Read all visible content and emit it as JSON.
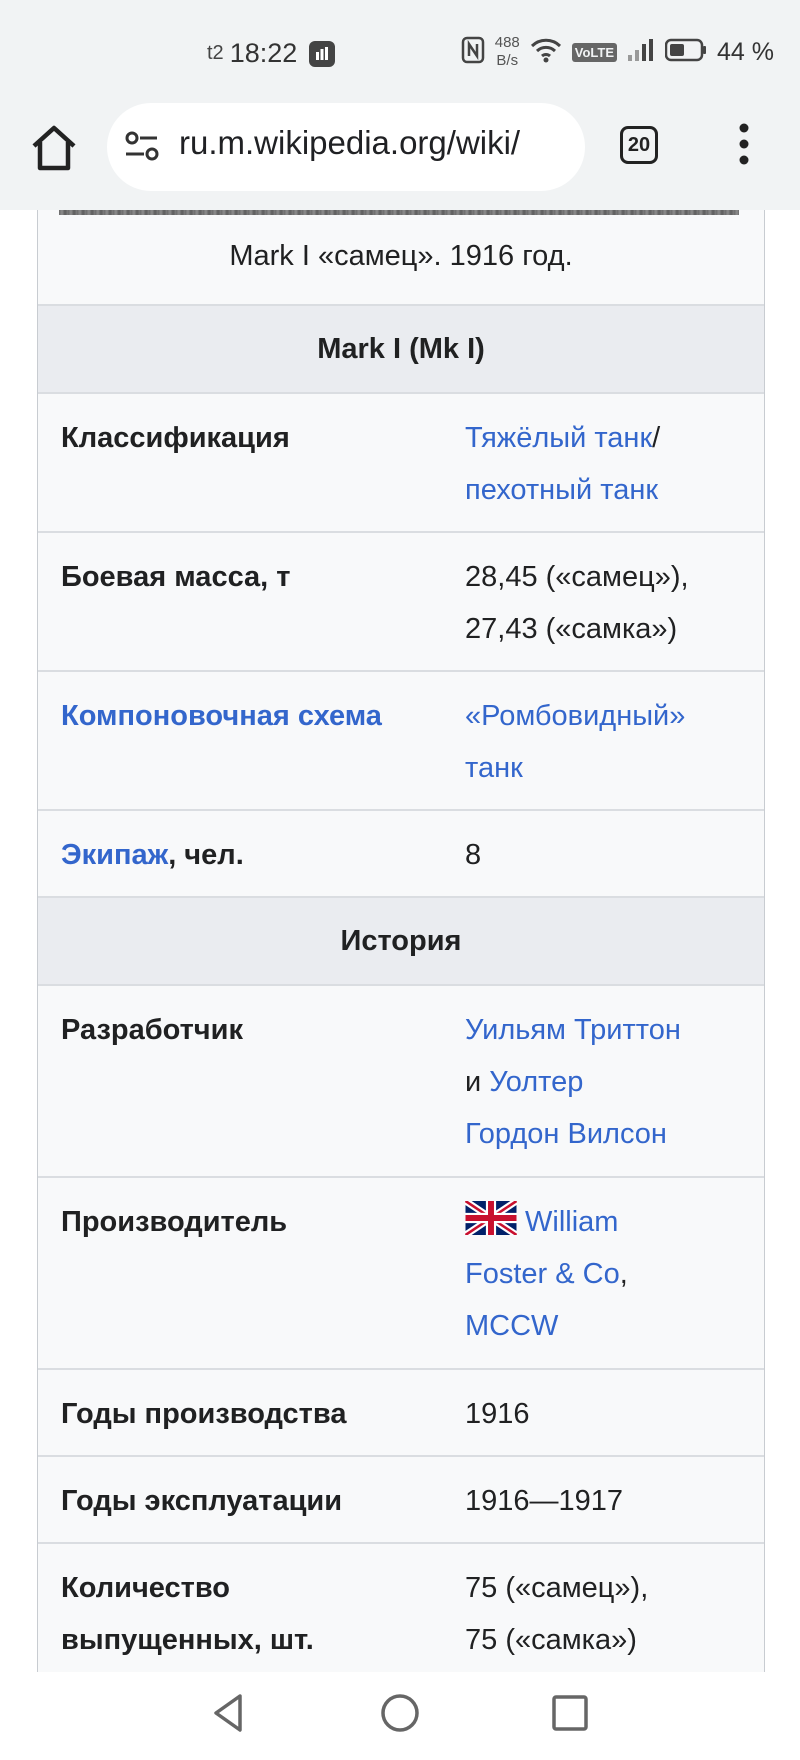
{
  "status_bar": {
    "carrier": "t2",
    "time": "18:22",
    "net_speed_value": "488",
    "net_speed_unit": "B/s",
    "volte": "VoLTE",
    "battery_percent": "44 %"
  },
  "browser": {
    "url": "ru.m.wikipedia.org/wiki/",
    "tab_count": "20"
  },
  "infobox": {
    "caption": "Mark I «самец». 1916 год.",
    "section_main": "Mark I (Mk I)",
    "classification": {
      "label": "Классификация",
      "link1": "Тяжёлый танк",
      "sep": "/",
      "link2": "пехотный танк"
    },
    "mass": {
      "label": "Боевая масса, т",
      "line1": "28,45 («самец»),",
      "line2": "27,43 («самка»)"
    },
    "layout": {
      "label": "Компоновочная схема",
      "line1": "«Ромбовидный»",
      "line2": "танк"
    },
    "crew": {
      "label_link": "Экипаж",
      "label_rest": ", чел.",
      "value": "8"
    },
    "section_history": "История",
    "developer": {
      "label": "Разработчик",
      "link1": "Уильям Триттон",
      "and": "и ",
      "link2_line1": "Уолтер",
      "link2_line2": "Гордон Вилсон"
    },
    "manufacturer": {
      "label": "Производитель",
      "flag_icon": "uk-flag-icon",
      "link1_line1": "William",
      "link1_line2": "Foster & Co",
      "comma": ",",
      "link2": "MCCW"
    },
    "prod_years": {
      "label": "Годы производства",
      "value": "1916"
    },
    "service_years": {
      "label": "Годы эксплуатации",
      "value": "1916—1917"
    },
    "quantity": {
      "label_line1": "Количество",
      "label_line2": "выпущенных, шт.",
      "line1": "75 («самец»),",
      "line2": "75 («самка»)"
    }
  },
  "colors": {
    "link": "#3366cc",
    "header_bg": "#eaecf0",
    "row_bg": "#f8f9fa",
    "border": "#dadde1"
  }
}
